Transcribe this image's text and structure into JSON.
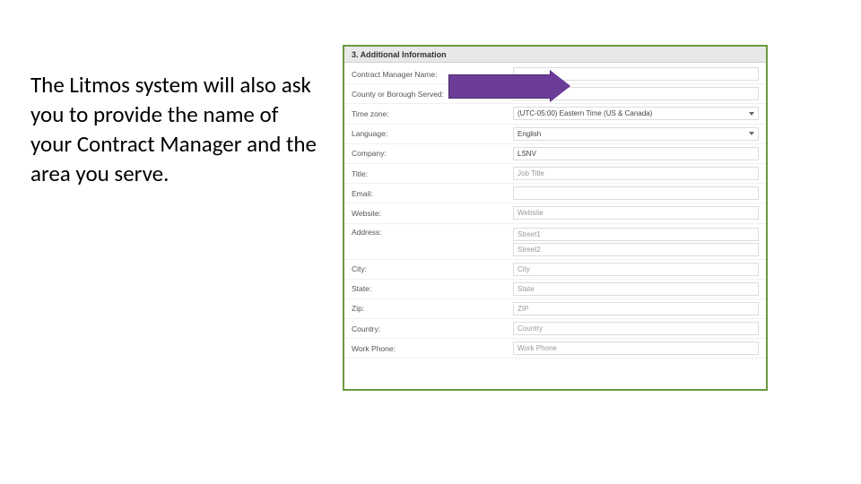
{
  "instruction_text": "The Litmos system will also ask you to provide the name of your Contract Manager and the area you serve.",
  "form": {
    "section_title": "3. Additional Information",
    "rows": {
      "contract_manager": {
        "label": "Contract Manager Name:",
        "placeholder": ""
      },
      "county_borough": {
        "label": "County or Borough Served:",
        "placeholder": ""
      },
      "timezone": {
        "label": "Time zone:",
        "value": "(UTC-05:00) Eastern Time (US & Canada)"
      },
      "language": {
        "label": "Language:",
        "value": "English"
      },
      "company": {
        "label": "Company:",
        "value": "LSNV"
      },
      "title": {
        "label": "Title:",
        "placeholder": "Job Title"
      },
      "email": {
        "label": "Email:",
        "placeholder": ""
      },
      "website": {
        "label": "Website:",
        "placeholder": "Website"
      },
      "address": {
        "label": "Address:",
        "placeholder1": "Street1",
        "placeholder2": "Street2"
      },
      "city": {
        "label": "City:",
        "placeholder": "City"
      },
      "state": {
        "label": "State:",
        "placeholder": "State"
      },
      "zip": {
        "label": "Zip:",
        "placeholder": "ZIP"
      },
      "country": {
        "label": "Country:",
        "placeholder": "Country"
      },
      "work_phone": {
        "label": "Work Phone:",
        "placeholder": "Work Phone"
      }
    }
  }
}
